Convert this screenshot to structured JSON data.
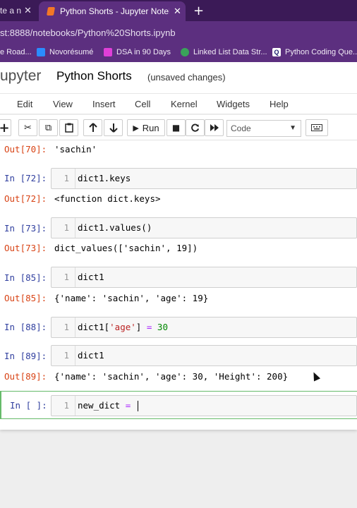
{
  "browser": {
    "prev_tab_title": "te a n",
    "active_tab_title": "Python Shorts - Jupyter Notebook",
    "close_glyph": "✕",
    "new_tab_glyph": "+",
    "address": "st:8888/notebooks/Python%20Shorts.ipynb",
    "bookmarks": [
      {
        "label": "e Road...",
        "icon": "road-icon",
        "color": "#888888"
      },
      {
        "label": "Novorésumé",
        "icon": "novoresume-icon",
        "color": "#2b8cff"
      },
      {
        "label": "DSA in 90 Days",
        "icon": "dsa-icon",
        "color": "#e03fd8"
      },
      {
        "label": "Linked List Data Str...",
        "icon": "linkedlist-icon",
        "color": "#3aa35a"
      },
      {
        "label": "Python Coding Que...",
        "icon": "q-icon",
        "color": "#1a1a6e"
      }
    ]
  },
  "jupyter": {
    "logo_text": "upyter",
    "notebook_name": "Python Shorts",
    "status": "(unsaved changes)",
    "menu": [
      "Edit",
      "View",
      "Insert",
      "Cell",
      "Kernel",
      "Widgets",
      "Help"
    ],
    "toolbar": {
      "add": "+",
      "cut": "✂",
      "copy": "⧉",
      "paste": "📋",
      "up": "🡑",
      "down": "🡓",
      "run_label": "Run",
      "run_icon": "▶",
      "stop": "■",
      "restart": "C",
      "fast_forward": "⏩",
      "cell_type": "Code",
      "keyboard": "⌨"
    }
  },
  "cells": {
    "out70": {
      "prompt": "Out[70]:",
      "text": "'sachin'"
    },
    "in72": {
      "prompt": "In [72]:",
      "line": "1",
      "code": "dict1.keys"
    },
    "out72": {
      "prompt": "Out[72]:",
      "text": "<function dict.keys>"
    },
    "in73": {
      "prompt": "In [73]:",
      "line": "1",
      "code": "dict1.values()"
    },
    "out73": {
      "prompt": "Out[73]:",
      "text": "dict_values(['sachin', 19])"
    },
    "in85": {
      "prompt": "In [85]:",
      "line": "1",
      "code": "dict1"
    },
    "out85": {
      "prompt": "Out[85]:",
      "text": "{'name': 'sachin', 'age': 19}"
    },
    "in88": {
      "prompt": "In [88]:",
      "line": "1",
      "code_a": "dict1[",
      "code_str": "'age'",
      "code_b": "] ",
      "code_op": "=",
      "code_c": " ",
      "code_num": "30"
    },
    "in89": {
      "prompt": "In [89]:",
      "line": "1",
      "code": "dict1"
    },
    "out89": {
      "prompt": "Out[89]:",
      "text": "{'name': 'sachin', 'age': 30, 'Height': 200}"
    },
    "in_new": {
      "prompt": "In [ ]:",
      "line": "1",
      "code": "new_dict ",
      "code_op": "="
    }
  }
}
